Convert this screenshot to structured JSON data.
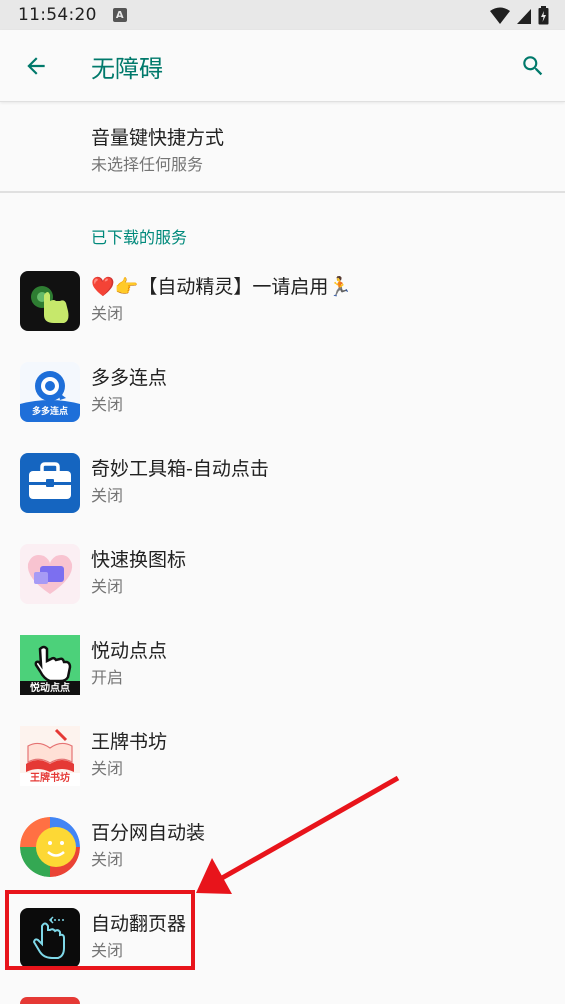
{
  "status_bar": {
    "time": "11:54:20",
    "notification_letter": "A"
  },
  "app_bar": {
    "title": "无障碍"
  },
  "shortcut": {
    "title": "音量键快捷方式",
    "subtitle": "未选择任何服务"
  },
  "downloaded_section": {
    "header": "已下载的服务",
    "items": [
      {
        "title": "❤️👉【自动精灵】一请启用🏃",
        "status": "关闭",
        "icon": "auto-sprite-app-icon"
      },
      {
        "title": "多多连点",
        "status": "关闭",
        "icon": "duoduo-clicker-app-icon",
        "icon_label": "多多连点"
      },
      {
        "title": "奇妙工具箱-自动点击",
        "status": "关闭",
        "icon": "toolbox-app-icon"
      },
      {
        "title": "快速换图标",
        "status": "关闭",
        "icon": "quick-icon-changer-app-icon"
      },
      {
        "title": "悦动点点",
        "status": "开启",
        "icon": "yuedong-app-icon",
        "icon_label": "悦动点点"
      },
      {
        "title": "王牌书坊",
        "status": "关闭",
        "icon": "book-app-icon",
        "icon_label": "王牌书坊"
      },
      {
        "title": "百分网自动装",
        "status": "关闭",
        "icon": "baifen-app-icon"
      },
      {
        "title": "自动翻页器",
        "status": "关闭",
        "icon": "auto-page-turner-app-icon"
      }
    ]
  },
  "colors": {
    "accent": "#00796b",
    "highlight": "#e8141b"
  }
}
